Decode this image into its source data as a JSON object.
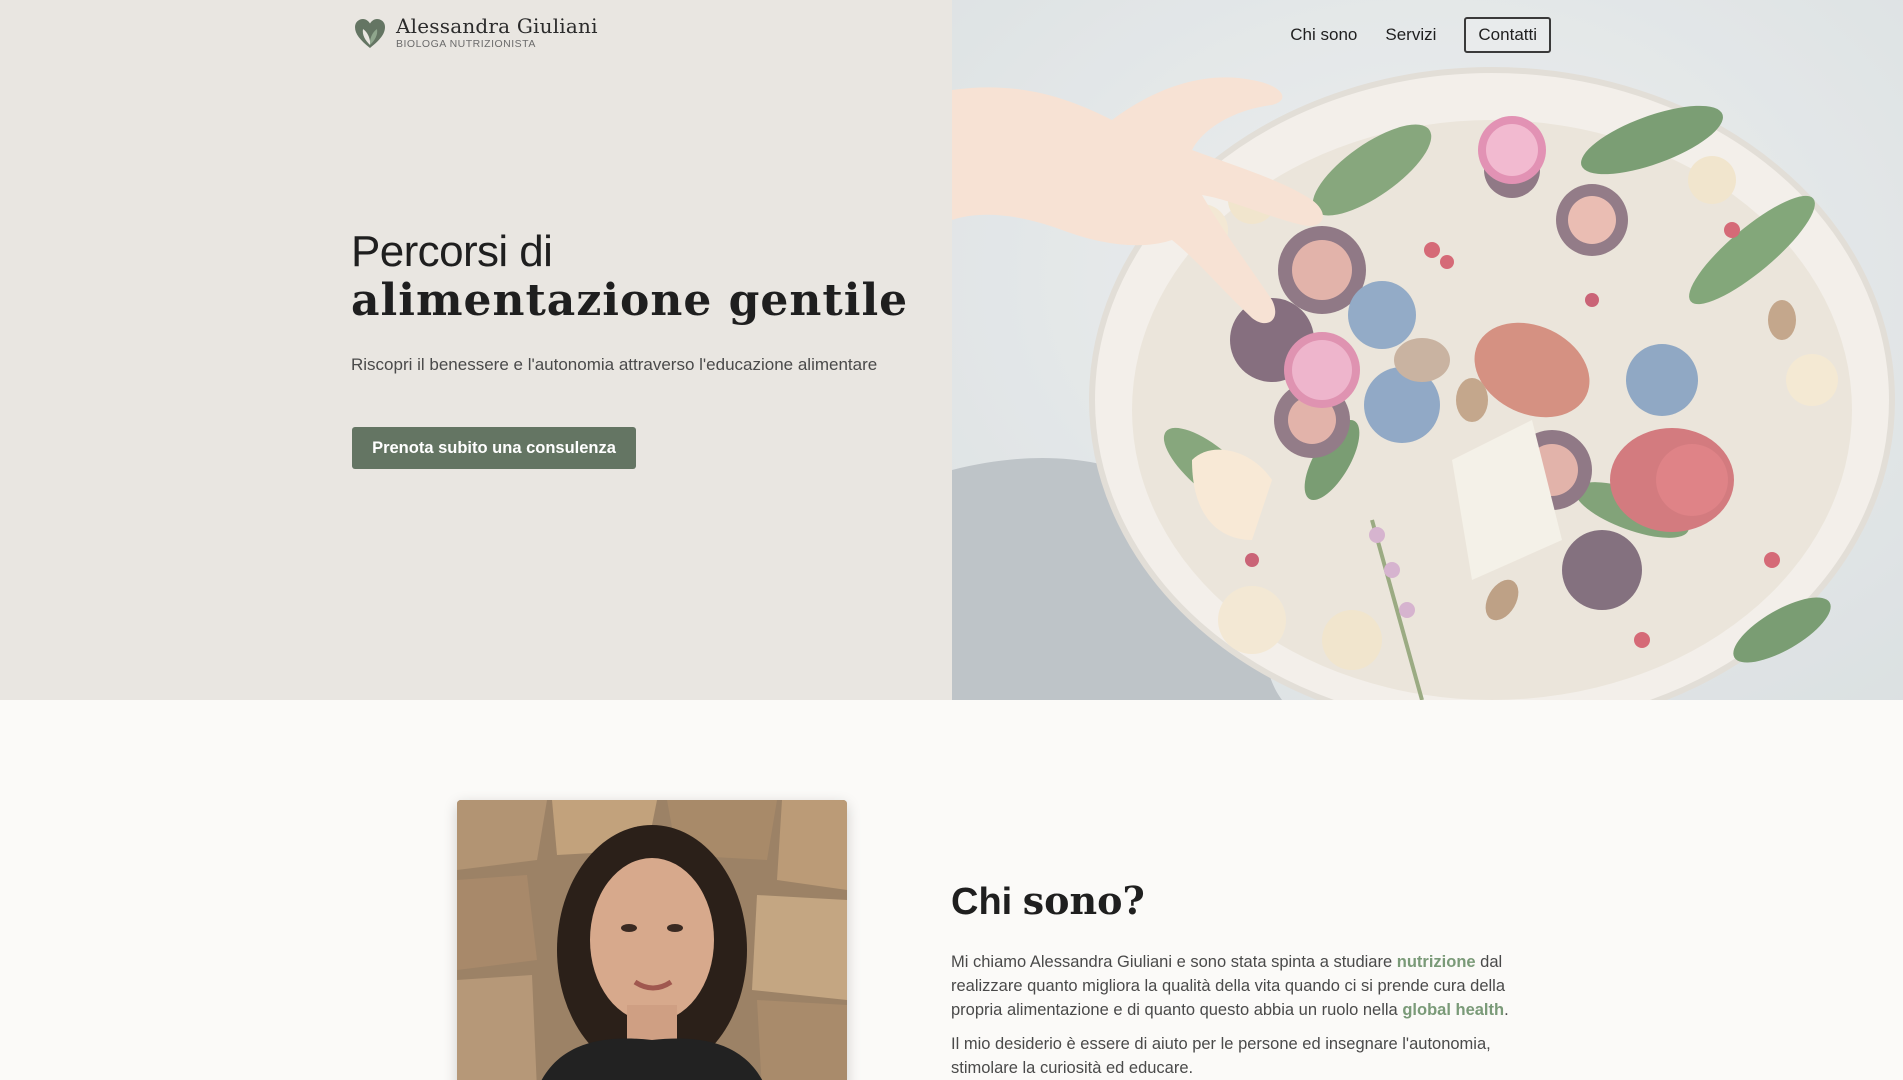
{
  "brand": {
    "name": "Alessandra Giuliani",
    "subtitle": "BIOLOGA NUTRIZIONISTA",
    "accent": "#647563",
    "highlight": "#7a9a78"
  },
  "nav": {
    "items": [
      {
        "label": "Chi sono"
      },
      {
        "label": "Servizi"
      }
    ],
    "cta": "Contatti"
  },
  "hero": {
    "title_line1": "Percorsi di",
    "title_line2": "alimentazione gentile",
    "subtitle": "Riscopri il benessere e l'autonomia attraverso l'educazione alimentare",
    "button": "Prenota subito una consulenza",
    "image": "food-platter-photo"
  },
  "about": {
    "title_a": "Chi ",
    "title_b": "sono?",
    "portrait": "portrait-photo",
    "p1_a": "Mi chiamo Alessandra Giuliani e sono stata spinta a studiare ",
    "p1_hl1": "nutrizione",
    "p1_b": " dal realizzare quanto migliora la qualità della vita quando ci si prende cura della propria alimentazione e di quanto questo abbia un ruolo nella ",
    "p1_hl2": "global health",
    "p1_c": ".",
    "p2": "Il mio desiderio è essere di aiuto per le persone ed insegnare l'autonomia, stimolare la curiosità ed educare."
  }
}
